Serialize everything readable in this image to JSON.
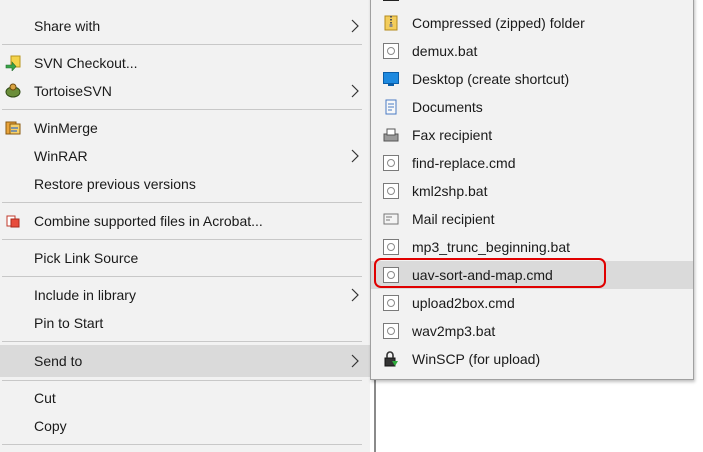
{
  "context_menu": {
    "items": [
      {
        "label": "Share with",
        "has_submenu": true
      },
      {
        "label": "SVN Checkout...",
        "has_submenu": false
      },
      {
        "label": "TortoiseSVN",
        "has_submenu": true
      },
      {
        "label": "WinMerge",
        "has_submenu": false
      },
      {
        "label": "WinRAR",
        "has_submenu": true
      },
      {
        "label": "Restore previous versions",
        "has_submenu": false
      },
      {
        "label": "Combine supported files in Acrobat...",
        "has_submenu": false
      },
      {
        "label": "Pick Link Source",
        "has_submenu": false
      },
      {
        "label": "Include in library",
        "has_submenu": true
      },
      {
        "label": "Pin to Start",
        "has_submenu": false
      },
      {
        "label": "Send to",
        "has_submenu": true,
        "highlighted": true
      },
      {
        "label": "Cut",
        "has_submenu": false
      },
      {
        "label": "Copy",
        "has_submenu": false
      }
    ]
  },
  "send_to_menu": {
    "items": [
      {
        "label": "Compressed (zipped) folder",
        "icon": "zip-folder-icon"
      },
      {
        "label": "demux.bat",
        "icon": "batch-file-icon"
      },
      {
        "label": "Desktop (create shortcut)",
        "icon": "desktop-icon"
      },
      {
        "label": "Documents",
        "icon": "documents-icon"
      },
      {
        "label": "Fax recipient",
        "icon": "fax-icon"
      },
      {
        "label": "find-replace.cmd",
        "icon": "batch-file-icon"
      },
      {
        "label": "kml2shp.bat",
        "icon": "batch-file-icon"
      },
      {
        "label": "Mail recipient",
        "icon": "mail-icon"
      },
      {
        "label": "mp3_trunc_beginning.bat",
        "icon": "batch-file-icon"
      },
      {
        "label": "uav-sort-and-map.cmd",
        "icon": "batch-file-icon",
        "highlighted": true
      },
      {
        "label": "upload2box.cmd",
        "icon": "batch-file-icon"
      },
      {
        "label": "wav2mp3.bat",
        "icon": "batch-file-icon"
      },
      {
        "label": "WinSCP (for upload)",
        "icon": "winscp-icon"
      }
    ]
  },
  "colors": {
    "menu_bg": "#f2f2f2",
    "highlight": "#dadada",
    "annotation_box": "#e00000"
  }
}
